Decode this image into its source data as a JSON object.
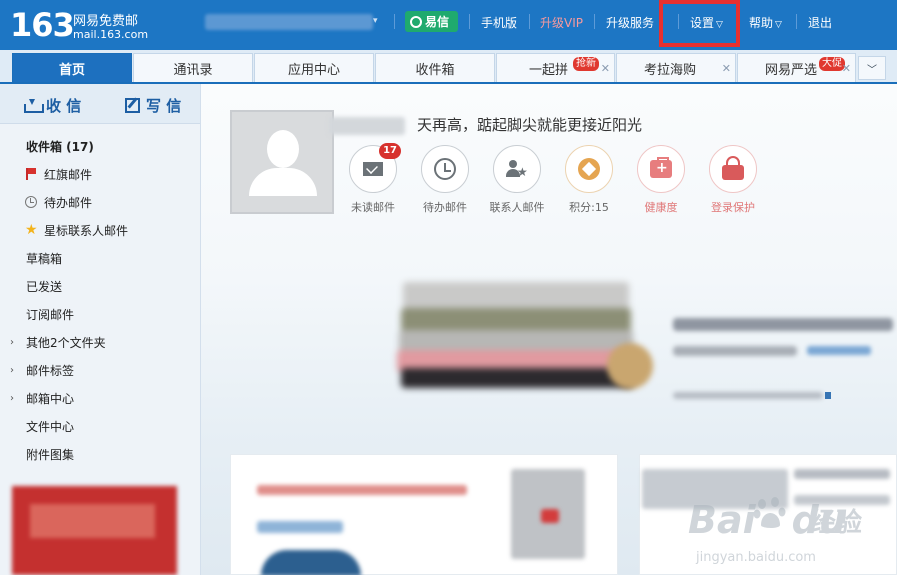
{
  "header": {
    "logo_number": "163",
    "logo_name": "网易免费邮",
    "logo_domain": "mail.163.com",
    "yixin_label": "易信",
    "nav": [
      {
        "label": "手机版"
      },
      {
        "label": "升级VIP"
      },
      {
        "label": "升级服务"
      },
      {
        "label": "设置"
      },
      {
        "label": "帮助"
      },
      {
        "label": "退出"
      }
    ],
    "accent_color": "#1d76c4",
    "highlight_color": "#e8302f"
  },
  "tabs": [
    {
      "label": "首页",
      "active": true
    },
    {
      "label": "通讯录"
    },
    {
      "label": "应用中心"
    },
    {
      "label": "收件箱"
    },
    {
      "label": "一起拼",
      "badge": "抢新",
      "closable": true
    },
    {
      "label": "考拉海购",
      "closable": true
    },
    {
      "label": "网易严选",
      "badge": "大促",
      "closable": true
    }
  ],
  "sidebar": {
    "receive_label": "收 信",
    "write_label": "写 信",
    "folders": [
      {
        "label": "收件箱 (17)"
      },
      {
        "label": "红旗邮件",
        "icon": "flag-icon"
      },
      {
        "label": "待办邮件",
        "icon": "clock-icon"
      },
      {
        "label": "星标联系人邮件",
        "icon": "star-icon"
      },
      {
        "label": "草稿箱"
      },
      {
        "label": "已发送"
      },
      {
        "label": "订阅邮件"
      },
      {
        "label": "其他2个文件夹",
        "expandable": true
      },
      {
        "label": "邮件标签",
        "expandable": true
      },
      {
        "label": "邮箱中心",
        "expandable": true
      },
      {
        "label": "文件中心"
      },
      {
        "label": "附件图集"
      }
    ]
  },
  "profile": {
    "motto": "天再高，踮起脚尖就能更接近阳光",
    "stats": [
      {
        "label": "未读邮件",
        "badge": "17",
        "icon": "envelope-icon"
      },
      {
        "label": "待办邮件",
        "icon": "clock-icon"
      },
      {
        "label": "联系人邮件",
        "icon": "contact-star-icon"
      },
      {
        "label": "积分:15",
        "icon": "coin-icon"
      },
      {
        "label": "健康度",
        "icon": "health-kit-icon"
      },
      {
        "label": "登录保护",
        "icon": "lock-icon"
      }
    ]
  },
  "watermark": {
    "logo": "Bai",
    "logo_tail": "du",
    "suffix": "经验",
    "url": "jingyan.baidu.com"
  }
}
